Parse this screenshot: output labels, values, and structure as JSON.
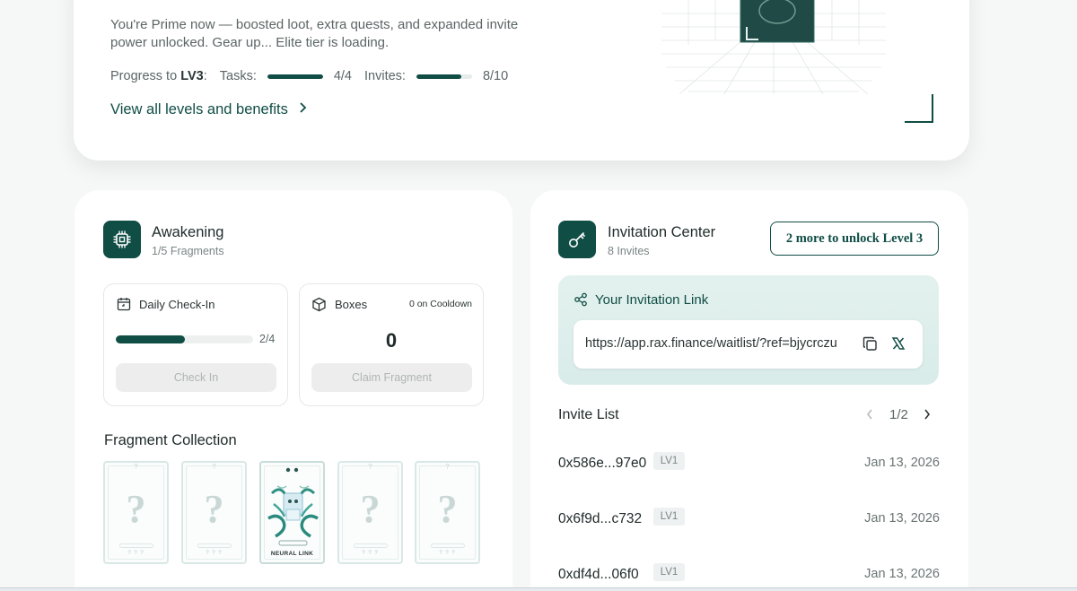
{
  "top_card": {
    "description": "You're Prime now — boosted loot, extra quests, and expanded invite power unlocked. Gear up... Elite tier is loading.",
    "progress_label": "Progress to",
    "progress_level": "LV3",
    "progress_colon": ":",
    "tasks_label": "Tasks:",
    "tasks_value": "4/4",
    "tasks_progress": 1.0,
    "invites_label": "Invites:",
    "invites_value": "8/10",
    "invites_progress": 0.8,
    "view_link": "View all levels and benefits",
    "view_icon": "chevron-right-icon"
  },
  "awakening": {
    "icon": "chip-icon",
    "title": "Awakening",
    "subtitle": "1/5 Fragments",
    "daily_checkin": {
      "icon": "calendar-icon",
      "label": "Daily Check-In",
      "value": "2/4",
      "progress": 0.5,
      "button": "Check In"
    },
    "boxes": {
      "icon": "box-icon",
      "label": "Boxes",
      "cooldown": "0 on Cooldown",
      "count": "0",
      "button": "Claim Fragment"
    },
    "collection_title": "Fragment Collection",
    "fragments": [
      {
        "state": "locked",
        "symbol": "?",
        "name": "? ? ?"
      },
      {
        "state": "locked",
        "symbol": "?",
        "name": "? ? ?"
      },
      {
        "state": "unlocked",
        "name": "NEURAL LINK"
      },
      {
        "state": "locked",
        "symbol": "?",
        "name": "? ? ?"
      },
      {
        "state": "locked",
        "symbol": "?",
        "name": "? ? ?"
      }
    ]
  },
  "invitation": {
    "icon": "key-icon",
    "title": "Invitation Center",
    "subtitle": "8 Invites",
    "unlock_button": "2 more to unlock Level 3",
    "link_title": "Your Invitation Link",
    "link_icon": "share-icon",
    "link_url": "https://app.rax.finance/waitlist/?ref=bjycrczu",
    "copy_icon": "copy-icon",
    "x_icon": "x-logo-icon",
    "list_title": "Invite List",
    "pagination": "1/2",
    "invites": [
      {
        "address": "0x586e...97e0",
        "level": "LV1",
        "date": "Jan 13, 2026"
      },
      {
        "address": "0x6f9d...c732",
        "level": "LV1",
        "date": "Jan 13, 2026"
      },
      {
        "address": "0xdf4d...06f0",
        "level": "LV1",
        "date": "Jan 13, 2026"
      }
    ]
  },
  "colors": {
    "brand": "#0f4d45",
    "panel": "#dcefec",
    "background": "#f6f7f7"
  }
}
